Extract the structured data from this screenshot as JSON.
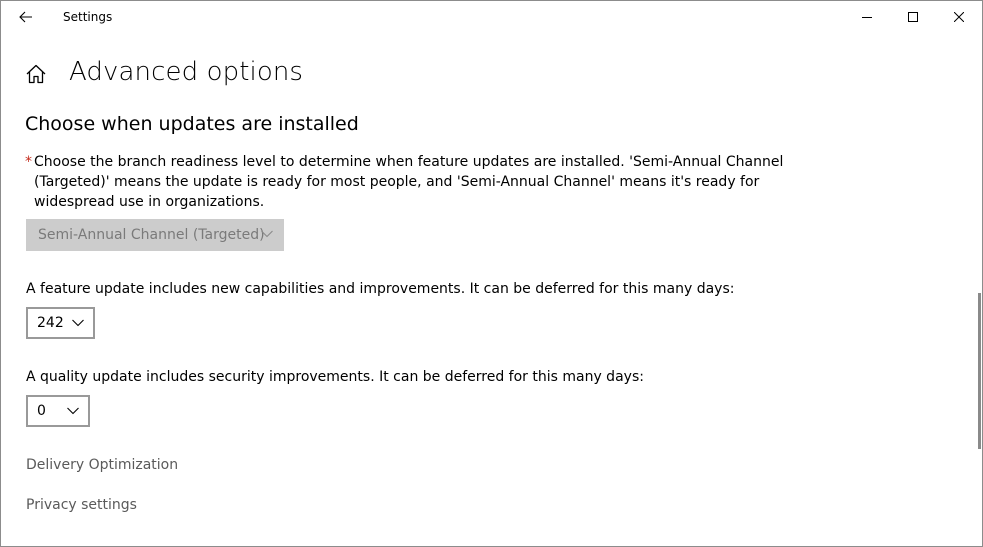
{
  "titlebar": {
    "app_title": "Settings",
    "icons": {
      "back": "back-arrow-icon",
      "minimize": "minimize-icon",
      "maximize": "maximize-icon",
      "close": "close-icon"
    }
  },
  "header": {
    "home_icon": "home-icon",
    "title": "Advanced options"
  },
  "section": {
    "title": "Choose when updates are installed",
    "required_marker": "*",
    "description": "Choose the branch readiness level to determine when feature updates are installed. 'Semi-Annual Channel (Targeted)' means the update is ready for most people, and 'Semi-Annual Channel' means it's ready for widespread use in organizations.",
    "branch_select": {
      "value": "Semi-Annual Channel (Targeted)",
      "disabled": true
    }
  },
  "feature_update": {
    "label": "A feature update includes new capabilities and improvements. It can be deferred for this many days:",
    "value": "242"
  },
  "quality_update": {
    "label": "A quality update includes security improvements. It can be deferred for this many days:",
    "value": "0"
  },
  "links": {
    "delivery_optimization": "Delivery Optimization",
    "privacy_settings": "Privacy settings"
  },
  "colors": {
    "required": "#c42b1c",
    "link": "#5a5a5a",
    "disabled_bg": "#cccccc",
    "disabled_text": "#7a7a7a",
    "combo_border": "#999999"
  }
}
